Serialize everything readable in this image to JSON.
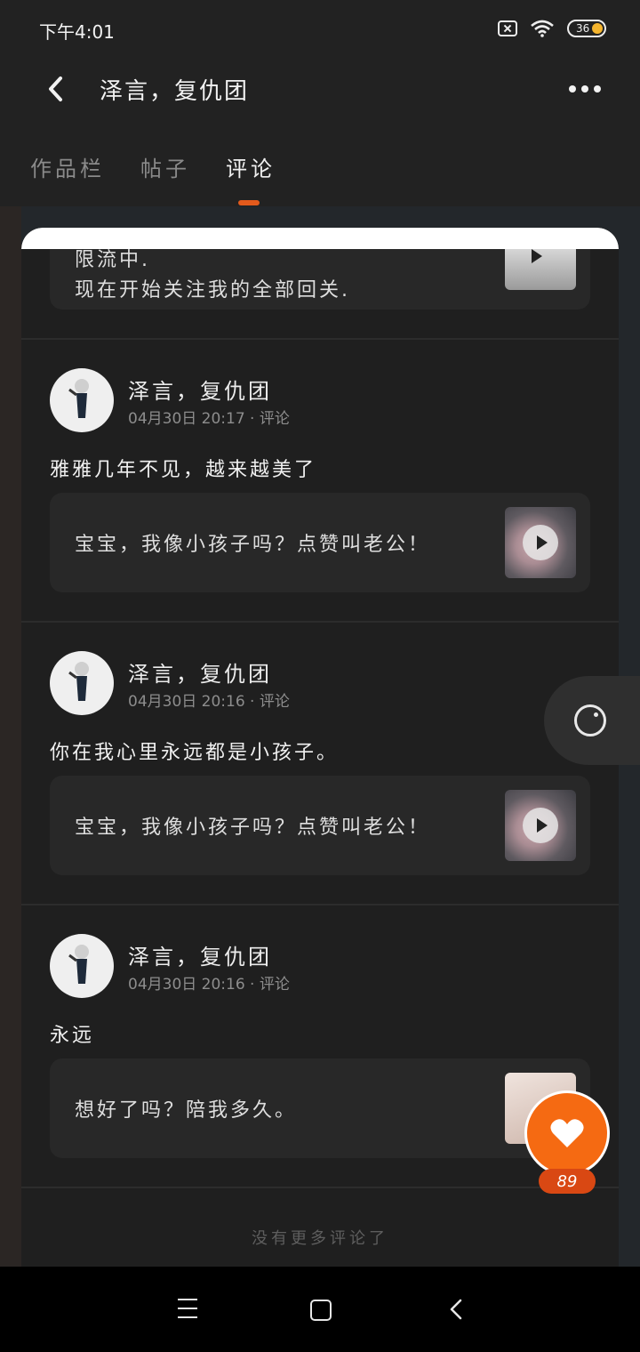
{
  "status_bar": {
    "time": "下午4:01",
    "battery": "36"
  },
  "header": {
    "title": "泽言，复仇团"
  },
  "tabs": [
    {
      "label": "作品栏"
    },
    {
      "label": "帖子"
    },
    {
      "label": "评论"
    }
  ],
  "first_partial": {
    "line1": "限流中.",
    "line2": "现在开始关注我的全部回关."
  },
  "comments": [
    {
      "name": "泽言，复仇团",
      "meta": "04月30日 20:17 · 评论",
      "text": "雅雅几年不见，越来越美了",
      "quote": "宝宝，我像小孩子吗？点赞叫老公！"
    },
    {
      "name": "泽言，复仇团",
      "meta": "04月30日 20:16 · 评论",
      "text": "你在我心里永远都是小孩子。",
      "quote": "宝宝，我像小孩子吗？点赞叫老公！"
    },
    {
      "name": "泽言，复仇团",
      "meta": "04月30日 20:16 · 评论",
      "text": "永远",
      "quote": "想好了吗？陪我多久。"
    }
  ],
  "footer": {
    "no_more": "没有更多评论了"
  },
  "like": {
    "count": "89"
  },
  "icons": {
    "back": "chevron-left-icon",
    "more": "more-dots-icon",
    "camera": "camera-icon",
    "like": "heart-icon"
  },
  "colors": {
    "accent": "#f56a12",
    "tab_indicator": "#e35a1c"
  }
}
